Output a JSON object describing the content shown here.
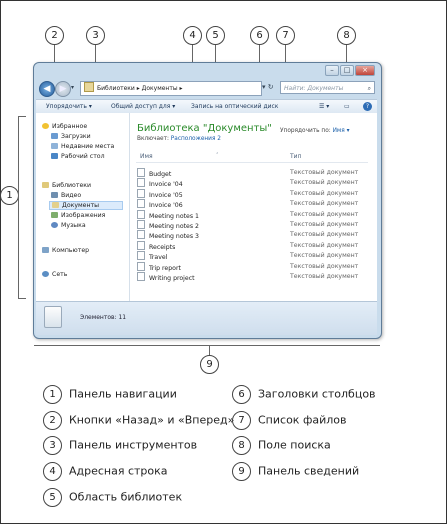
{
  "window": {
    "address_path": "Библиотеки ▸ Документы ▸",
    "search_placeholder": "Найти: Документы",
    "toolbar": {
      "organize": "Упорядочить ▾",
      "share": "Общий доступ для ▾",
      "burn": "Запись на оптический диск"
    },
    "nav": {
      "favorites": "Избранное",
      "downloads": "Загрузки",
      "recent": "Недавние места",
      "desktop": "Рабочий стол",
      "libraries": "Библиотеки",
      "video": "Видео",
      "documents": "Документы",
      "images": "Изображения",
      "music": "Музыка",
      "computer": "Компьютер",
      "network": "Сеть"
    },
    "library_title": "Библиотека \"Документы\"",
    "includes_label": "Включает:",
    "includes_value": "Расположения 2",
    "arrange_label": "Упорядочить по:",
    "arrange_value": "Имя ▾",
    "columns": {
      "name": "Имя",
      "type": "Тип"
    },
    "files": [
      {
        "name": "Budget",
        "type": "Текстовый документ"
      },
      {
        "name": "Invoice '04",
        "type": "Текстовый документ"
      },
      {
        "name": "Invoice '05",
        "type": "Текстовый документ"
      },
      {
        "name": "Invoice '06",
        "type": "Текстовый документ"
      },
      {
        "name": "Meeting notes 1",
        "type": "Текстовый документ"
      },
      {
        "name": "Meeting notes 2",
        "type": "Текстовый документ"
      },
      {
        "name": "Meeting notes 3",
        "type": "Текстовый документ"
      },
      {
        "name": "Receipts",
        "type": "Текстовый документ"
      },
      {
        "name": "Travel",
        "type": "Текстовый документ"
      },
      {
        "name": "Trip report",
        "type": "Текстовый документ"
      },
      {
        "name": "Writing project",
        "type": "Текстовый документ"
      }
    ],
    "details_text": "Элементов: 11"
  },
  "callouts": [
    "1",
    "2",
    "3",
    "4",
    "5",
    "6",
    "7",
    "8",
    "9"
  ],
  "legend": [
    {
      "num": "1",
      "label": "Панель навигации"
    },
    {
      "num": "2",
      "label": "Кнопки «Назад» и «Вперед»"
    },
    {
      "num": "3",
      "label": "Панель инструментов"
    },
    {
      "num": "4",
      "label": "Адресная строка"
    },
    {
      "num": "5",
      "label": "Область библиотек"
    },
    {
      "num": "6",
      "label": "Заголовки столбцов"
    },
    {
      "num": "7",
      "label": "Список файлов"
    },
    {
      "num": "8",
      "label": "Поле поиска"
    },
    {
      "num": "9",
      "label": "Панель сведений"
    }
  ],
  "colors": {
    "library_title": "#2a8a2a",
    "link": "#1b5fa9",
    "window_frame": "#c9dcec"
  }
}
